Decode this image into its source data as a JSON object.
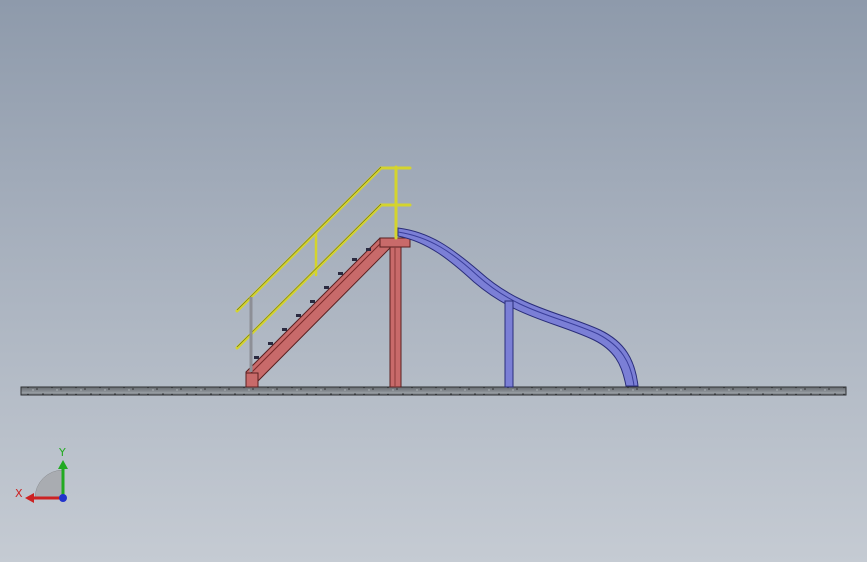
{
  "view": {
    "background_top": "#8e9aab",
    "background_bottom": "#c5cbd3"
  },
  "model": {
    "parts": {
      "ground_plate": {
        "color": "#5a5e62"
      },
      "stair_stringer": {
        "color": "#c86a6a"
      },
      "handrail": {
        "color": "#e3e33a"
      },
      "slide": {
        "color": "#7b7fd6"
      }
    }
  },
  "triad": {
    "x_label": "X",
    "y_label": "Y",
    "x_color": "#cc2222",
    "y_color": "#22aa22",
    "z_color": "#2233cc"
  }
}
